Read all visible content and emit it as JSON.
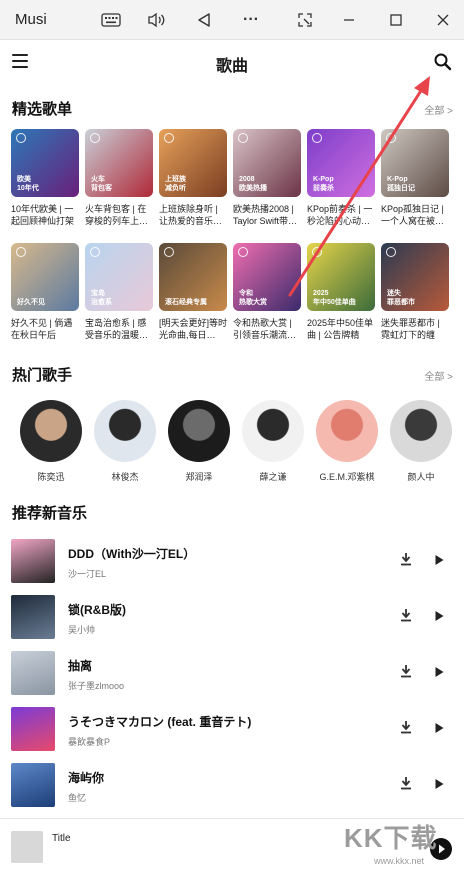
{
  "window": {
    "app_name": "Musi",
    "controls": [
      "keyboard-icon",
      "volume-icon",
      "back-triangle-icon",
      "more-dots-icon",
      "screenshot-icon",
      "minimize-icon",
      "maximize-icon",
      "close-icon"
    ],
    "more_dots": "···"
  },
  "header": {
    "title": "歌曲"
  },
  "featured": {
    "title": "精选歌单",
    "more": "全部 >",
    "playlists": [
      {
        "tag1": "欧美",
        "tag2": "10年代",
        "name": "10年代欧美 | 一起回顾神仙打架",
        "colors": [
          "#2d78b8",
          "#6a1f7a"
        ]
      },
      {
        "tag1": "火车",
        "tag2": "背包客",
        "name": "火车背包客 | 在穿梭的列车上…",
        "colors": [
          "#c9d0d8",
          "#b02838"
        ]
      },
      {
        "tag1": "上班族",
        "tag2": "减负听",
        "name": "上班族除身听 | 让热爱的音乐…",
        "colors": [
          "#e6a15a",
          "#7a3d22"
        ]
      },
      {
        "tag1": "2008",
        "tag2": "欧美热播",
        "name": "欧美热播2008 | Taylor Swift带…",
        "colors": [
          "#d9c4c8",
          "#6b3346"
        ]
      },
      {
        "tag1": "K-Pop",
        "tag2": "前奏杀",
        "name": "KPop前奏杀 | 一秒沦陷的心动…",
        "colors": [
          "#7d3ec9",
          "#d06fe0"
        ]
      },
      {
        "tag1": "K-Pop",
        "tag2": "孤独日记",
        "name": "KPop孤独日记 | 一个人窝在被…",
        "colors": [
          "#cfc8c2",
          "#5d4b45"
        ]
      },
      {
        "tag1": "好久不见",
        "tag2": "",
        "name": "好久不见 | 倘遇在秋日午后",
        "colors": [
          "#d8b98c",
          "#5b7aa0"
        ]
      },
      {
        "tag1": "宝岛",
        "tag2": "治愈系",
        "name": "宝岛治愈系 | 感受音乐的温暖…",
        "colors": [
          "#b9d4ee",
          "#e8c9d8"
        ]
      },
      {
        "tag1": "滚石经典专属",
        "tag2": "",
        "name": "[明天会更好]等时光命曲,每日…",
        "colors": [
          "#5a4a3a",
          "#c88a4a"
        ]
      },
      {
        "tag1": "令和",
        "tag2": "热歌大赏",
        "name": "令和热歌大赏 | 引领音乐潮流…",
        "colors": [
          "#f06fb0",
          "#3a2a6a"
        ]
      },
      {
        "tag1": "2025",
        "tag2": "年中50佳单曲",
        "name": "2025年中50佳单曲 | 公告牌精选…",
        "colors": [
          "#e7d44a",
          "#3b6b3a"
        ]
      },
      {
        "tag1": "迷失",
        "tag2": "罪恶都市",
        "name": "迷失罪恶都市 | 霓虹灯下的缠绵…",
        "colors": [
          "#2b3a52",
          "#b85a3a"
        ]
      }
    ]
  },
  "artists": {
    "title": "热门歌手",
    "more": "全部 >",
    "items": [
      {
        "name": "陈奕迅",
        "colors": [
          "#2a2a2a",
          "#c9a487"
        ]
      },
      {
        "name": "林俊杰",
        "colors": [
          "#dfe6ee",
          "#2a2a2a"
        ]
      },
      {
        "name": "郑润泽",
        "colors": [
          "#1c1c1c",
          "#6b6b6b"
        ]
      },
      {
        "name": "薛之谦",
        "colors": [
          "#f1f1f1",
          "#2b2b2b"
        ]
      },
      {
        "name": "G.E.M.邓紫棋",
        "colors": [
          "#f5b9b0",
          "#e07d6e"
        ]
      },
      {
        "name": "颜人中",
        "colors": [
          "#d9d9d9",
          "#3a3a3a"
        ]
      }
    ]
  },
  "new_music": {
    "title": "推荐新音乐",
    "songs": [
      {
        "title": "DDD（With沙一汀EL）",
        "artist": "沙一汀EL",
        "colors": [
          "#f2a7c7",
          "#222222"
        ]
      },
      {
        "title": "锁(R&B版)",
        "artist": "吴小帅",
        "colors": [
          "#1e2a3a",
          "#6b7d95"
        ]
      },
      {
        "title": "抽离",
        "artist": "张子墨zlmooo",
        "colors": [
          "#c8cfd8",
          "#8a95a3"
        ]
      },
      {
        "title": "うそつきマカロン (feat. 重音テト)",
        "artist": "暴飲暴食P",
        "colors": [
          "#7b3bd6",
          "#e84a6a"
        ]
      },
      {
        "title": "海屿你",
        "artist": "鱼忆",
        "colors": [
          "#5d88c8",
          "#1d3e78"
        ]
      }
    ]
  },
  "player": {
    "title": "Title"
  },
  "watermark": {
    "text": "KK下载",
    "url": "www.kkx.net"
  },
  "colors": {
    "arrow": "#e8434a",
    "accent_text": "#111111"
  }
}
